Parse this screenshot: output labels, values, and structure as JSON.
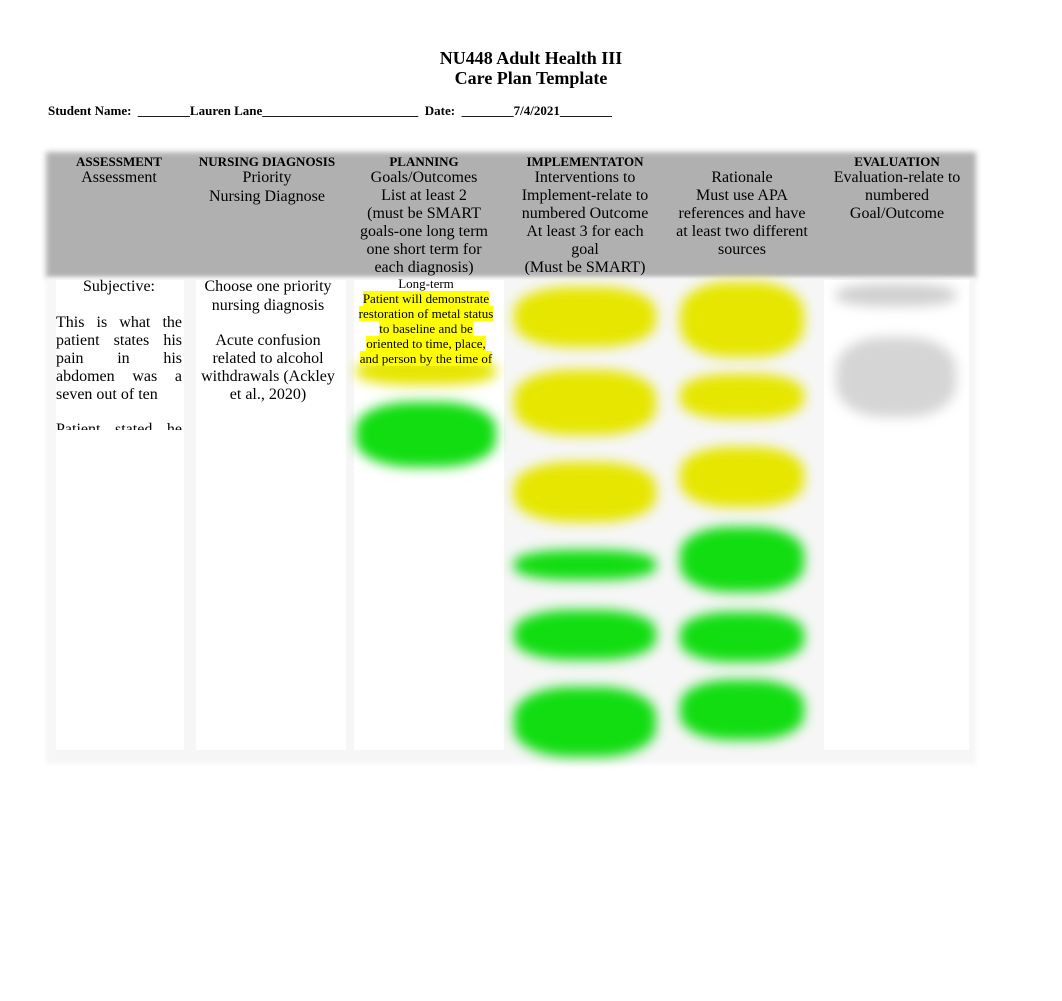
{
  "document": {
    "title_line1": "NU448 Adult Health III",
    "title_line2": "Care Plan Template",
    "student_name_label": "Student Name:",
    "student_name_value": "________Lauren Lane________________________",
    "date_label": "Date:",
    "date_value": "________7/4/2021________"
  },
  "table": {
    "columns": [
      {
        "heading": "ASSESSMENT",
        "lines": [
          "Assessment"
        ]
      },
      {
        "heading": "NURSING DIAGNOSIS",
        "lines": [
          "Priority",
          "Nursing Diagnose"
        ]
      },
      {
        "heading": "PLANNING",
        "lines": [
          "Goals/Outcomes",
          "List at least 2",
          "(must be SMART",
          "goals-one long term",
          "one short term for",
          "each diagnosis)"
        ]
      },
      {
        "heading": "IMPLEMENTATON",
        "lines": [
          "Interventions to",
          "Implement-relate to",
          "numbered Outcome",
          "At least 3 for each",
          "goal",
          "(Must be SMART)"
        ]
      },
      {
        "heading": "",
        "lines": [
          "Rationale",
          "Must use APA",
          "references and have",
          "at least two different",
          "sources"
        ]
      },
      {
        "heading": "EVALUATION",
        "lines": [
          "Evaluation-relate to",
          "numbered",
          "Goal/Outcome"
        ]
      }
    ],
    "assessment": {
      "subjective_label": "Subjective:",
      "paragraph1": [
        "This is what the",
        "patient states his",
        "pain in his",
        "abdomen was a",
        "seven out of ten"
      ],
      "paragraph2_partial": "Patient stated he"
    },
    "diagnosis": {
      "instruction": [
        "Choose one priority",
        "nursing diagnosis"
      ],
      "diagnosis_text": [
        "Acute confusion",
        "related to alcohol",
        "withdrawals (Ackley",
        "et al., 2020)"
      ]
    },
    "planning": {
      "long_term_label": "Long-term",
      "goal_text": [
        "Patient will demonstrate",
        "restoration of metal status",
        "to baseline and be",
        "oriented to time, place,",
        "and person by the time of"
      ]
    }
  }
}
